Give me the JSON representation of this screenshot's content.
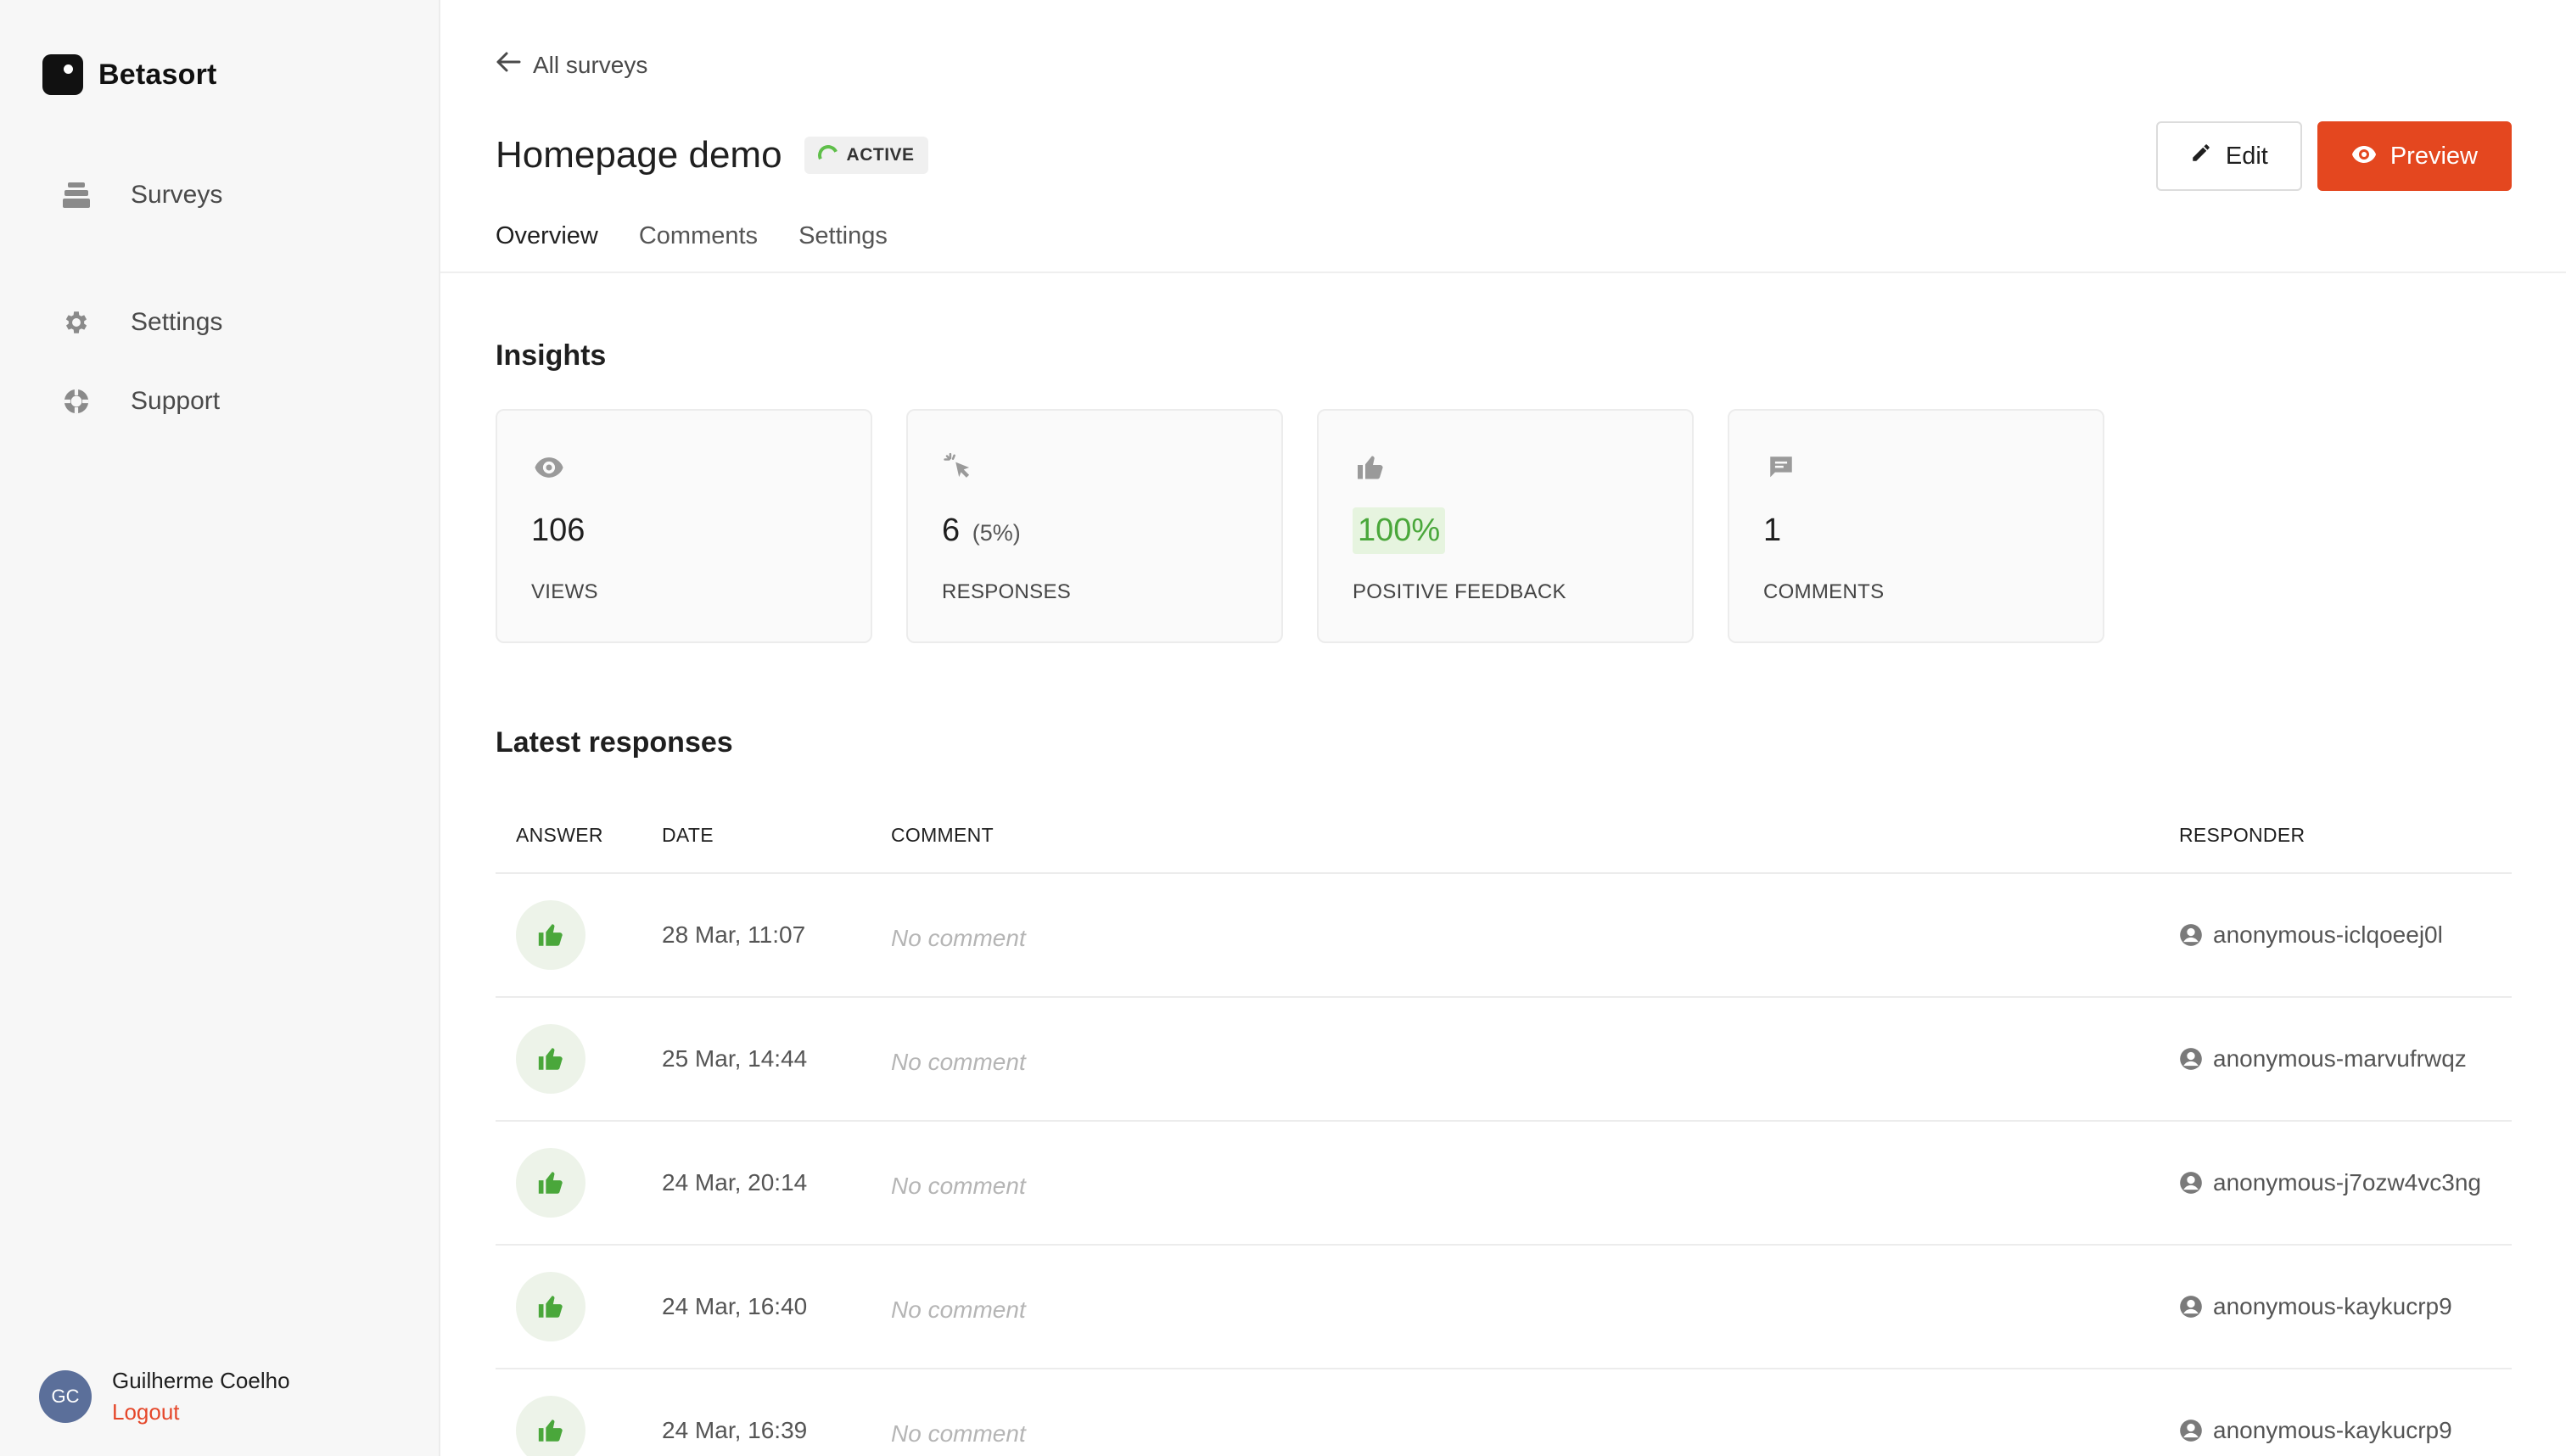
{
  "app": {
    "name": "Betasort"
  },
  "sidebar": {
    "items": [
      {
        "label": "Surveys",
        "icon": "layers-icon"
      },
      {
        "label": "Settings",
        "icon": "gear-icon"
      },
      {
        "label": "Support",
        "icon": "lifebuoy-icon"
      }
    ]
  },
  "user": {
    "initials": "GC",
    "name": "Guilherme Coelho",
    "logout": "Logout"
  },
  "header": {
    "back_label": "All surveys",
    "title": "Homepage demo",
    "status": "ACTIVE",
    "edit_label": "Edit",
    "preview_label": "Preview"
  },
  "tabs": [
    {
      "label": "Overview",
      "active": true
    },
    {
      "label": "Comments",
      "active": false
    },
    {
      "label": "Settings",
      "active": false
    }
  ],
  "insights": {
    "title": "Insights",
    "cards": [
      {
        "icon": "eye-icon",
        "value": "106",
        "sub": "",
        "label": "VIEWS"
      },
      {
        "icon": "cursor-click-icon",
        "value": "6",
        "sub": "(5%)",
        "label": "RESPONSES"
      },
      {
        "icon": "thumbs-up-icon",
        "value": "100%",
        "sub": "",
        "label": "POSITIVE FEEDBACK"
      },
      {
        "icon": "comment-icon",
        "value": "1",
        "sub": "",
        "label": "COMMENTS"
      }
    ]
  },
  "responses": {
    "title": "Latest responses",
    "columns": {
      "answer": "ANSWER",
      "date": "DATE",
      "comment": "COMMENT",
      "responder": "RESPONDER"
    },
    "rows": [
      {
        "answer": "thumbs-up-icon",
        "date": "28 Mar, 11:07",
        "comment": "No comment",
        "responder": "anonymous-iclqoeej0l"
      },
      {
        "answer": "thumbs-up-icon",
        "date": "25 Mar, 14:44",
        "comment": "No comment",
        "responder": "anonymous-marvufrwqz"
      },
      {
        "answer": "thumbs-up-icon",
        "date": "24 Mar, 20:14",
        "comment": "No comment",
        "responder": "anonymous-j7ozw4vc3ng"
      },
      {
        "answer": "thumbs-up-icon",
        "date": "24 Mar, 16:40",
        "comment": "No comment",
        "responder": "anonymous-kaykucrp9"
      },
      {
        "answer": "thumbs-up-icon",
        "date": "24 Mar, 16:39",
        "comment": "No comment",
        "responder": "anonymous-kaykucrp9"
      }
    ]
  },
  "colors": {
    "accent": "#e4471f",
    "positive": "#4aa73b",
    "logout": "#e5472a"
  }
}
